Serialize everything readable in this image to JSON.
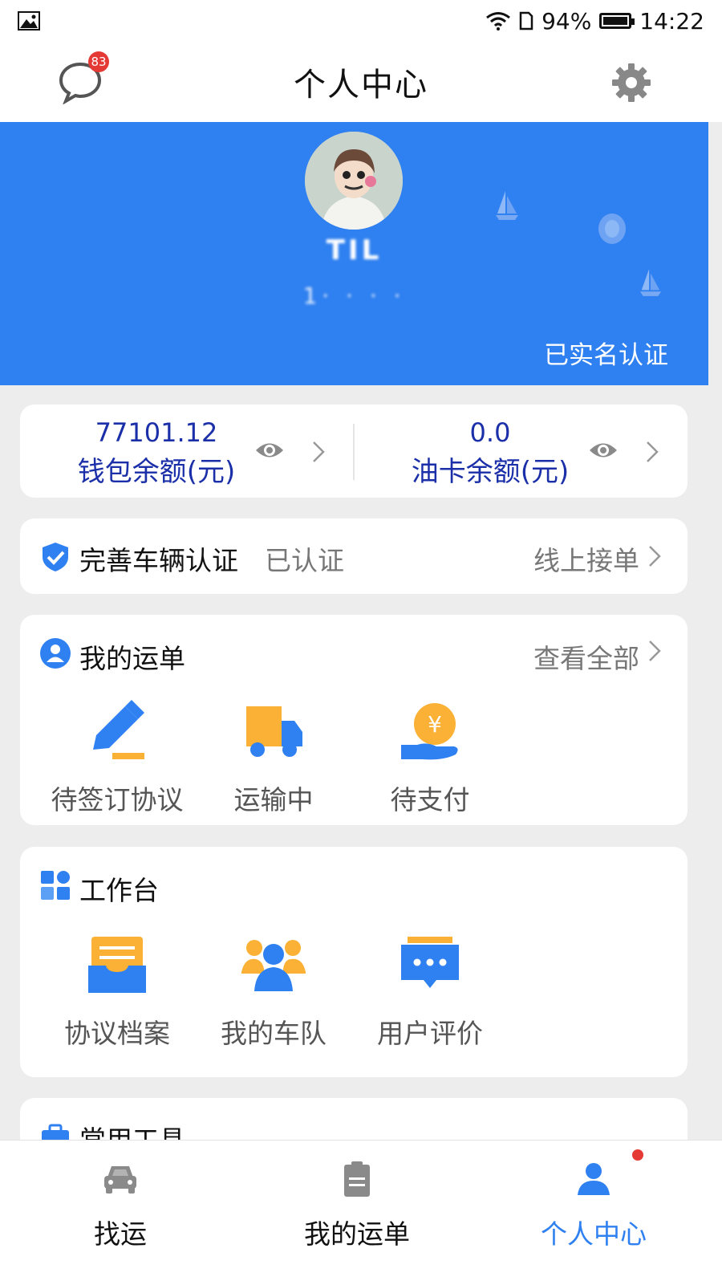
{
  "status_bar": {
    "battery": "94%",
    "time": "14:22"
  },
  "header": {
    "title": "个人中心",
    "message_badge": "83"
  },
  "profile": {
    "name": "TIL",
    "phone": "1· · · ·",
    "verified_label": "已实名认证"
  },
  "balances": [
    {
      "value": "77101.12",
      "label": "钱包余额(元)"
    },
    {
      "value": "0.0",
      "label": "油卡余额(元)"
    }
  ],
  "vehicle": {
    "title": "完善车辆认证",
    "status": "已认证",
    "link": "线上接单"
  },
  "orders": {
    "title": "我的运单",
    "view_all": "查看全部",
    "items": [
      {
        "label": "待签订协议",
        "icon": "pen-icon"
      },
      {
        "label": "运输中",
        "icon": "truck-icon"
      },
      {
        "label": "待支付",
        "icon": "yuan-hand-icon"
      }
    ]
  },
  "workbench": {
    "title": "工作台",
    "items": [
      {
        "label": "协议档案",
        "icon": "archive-icon"
      },
      {
        "label": "我的车队",
        "icon": "team-icon"
      },
      {
        "label": "用户评价",
        "icon": "chat-icon"
      }
    ]
  },
  "tools": {
    "title": "常用工具"
  },
  "tabbar": {
    "items": [
      {
        "label": "找运",
        "icon": "car-icon"
      },
      {
        "label": "我的运单",
        "icon": "document-icon"
      },
      {
        "label": "个人中心",
        "icon": "person-icon"
      }
    ],
    "active_index": 2
  },
  "colors": {
    "primary": "#2f80f0",
    "accent_orange": "#fbb135",
    "badge_red": "#e53935",
    "balance_text": "#1a2fa8"
  }
}
